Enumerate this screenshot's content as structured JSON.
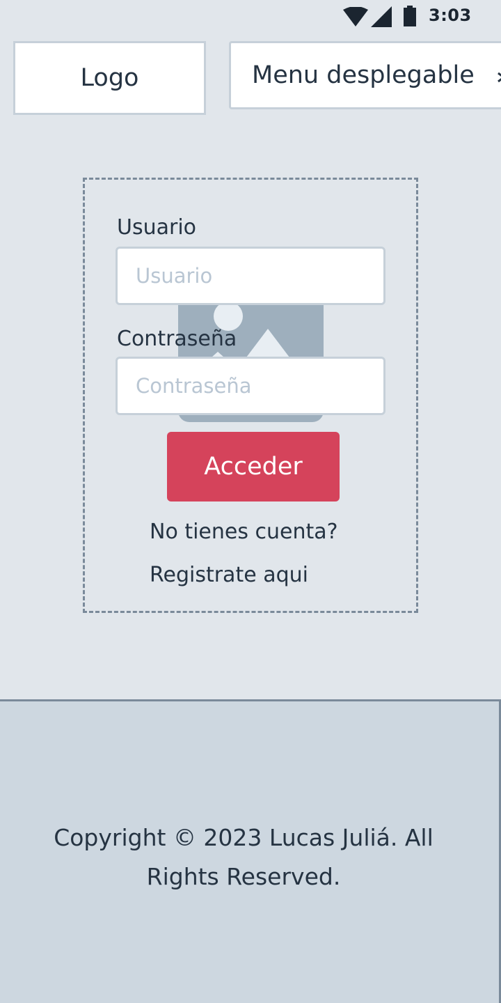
{
  "status_bar": {
    "time": "3:03",
    "icons": [
      "wifi-icon",
      "signal-icon",
      "battery-icon"
    ]
  },
  "header": {
    "logo_label": "Logo",
    "menu_label": "Menu desplegable",
    "menu_icon": "chevron-icon"
  },
  "login": {
    "username_label": "Usuario",
    "username_placeholder": "Usuario",
    "password_label": "Contraseña",
    "password_placeholder": "Contraseña",
    "submit_label": "Acceder",
    "no_account_text": "No tienes cuenta?",
    "register_link": "Registrate aqui",
    "image_icon": "image-placeholder-icon"
  },
  "footer": {
    "copyright": "Copyright © 2023 Lucas Juliá. All Rights Reserved."
  },
  "colors": {
    "background": "#e1e6eb",
    "accent": "#d5435b",
    "footer_bg": "#cdd7e0",
    "text": "#253342"
  }
}
